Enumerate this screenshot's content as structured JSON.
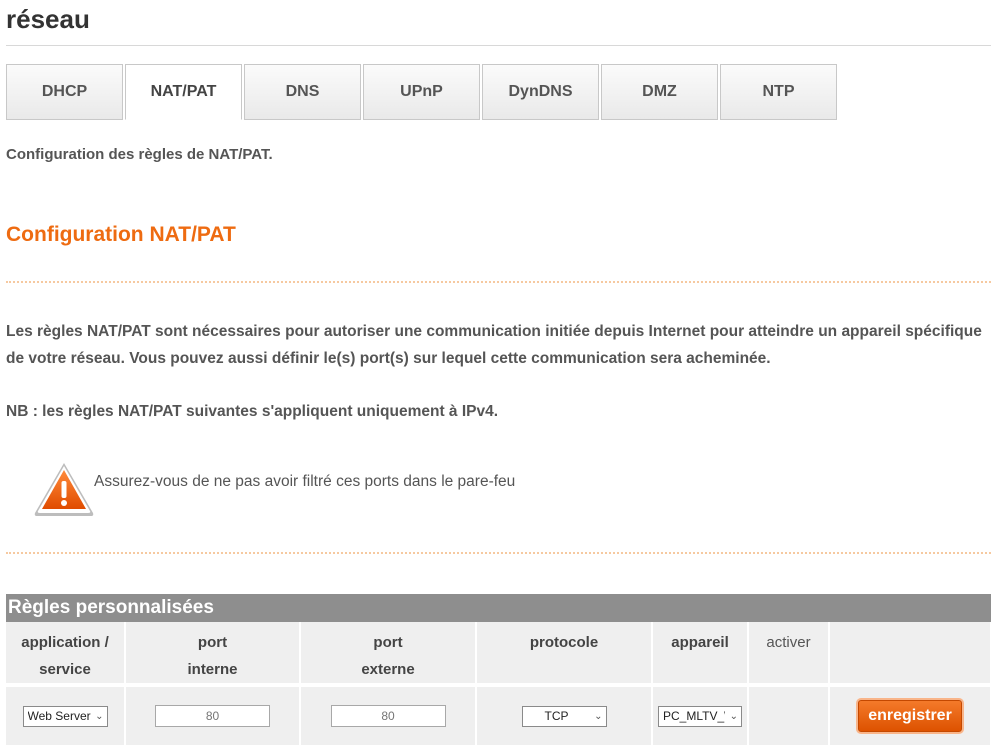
{
  "page": {
    "title": "réseau",
    "subtitle": "Configuration des règles de NAT/PAT.",
    "section_title": "Configuration NAT/PAT",
    "description": "Les règles NAT/PAT sont nécessaires pour autoriser une communication initiée depuis Internet pour atteindre un appareil spécifique de votre réseau. Vous pouvez aussi définir le(s) port(s) sur lequel cette communication sera acheminée.",
    "nb": "NB : les règles NAT/PAT suivantes s'appliquent uniquement à IPv4.",
    "warning": "Assurez-vous de ne pas avoir filtré ces ports dans le pare-feu"
  },
  "tabs": [
    {
      "label": "DHCP"
    },
    {
      "label": "NAT/PAT",
      "active": true
    },
    {
      "label": "DNS"
    },
    {
      "label": "UPnP"
    },
    {
      "label": "DynDNS"
    },
    {
      "label": "DMZ"
    },
    {
      "label": "NTP"
    }
  ],
  "rules": {
    "title": "Règles personnalisées",
    "headers": {
      "application_1": "application /",
      "application_2": "service",
      "port_int_1": "port",
      "port_int_2": "interne",
      "port_ext_1": "port",
      "port_ext_2": "externe",
      "protocol": "protocole",
      "device": "appareil",
      "activate": "activer"
    },
    "row": {
      "application": "Web Server",
      "internal_port_placeholder": "80",
      "external_port_placeholder": "80",
      "protocol": "TCP",
      "device": "PC_MLTV_\\",
      "save_label": "enregistrer"
    }
  },
  "colors": {
    "accent": "#ee6b11",
    "header_bar": "#8e8e8e"
  }
}
